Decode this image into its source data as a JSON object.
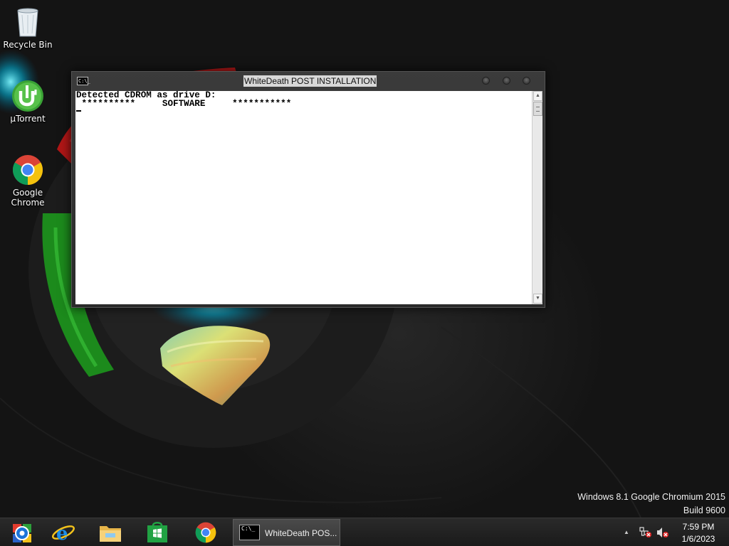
{
  "desktop": {
    "icons": [
      {
        "label": "Recycle Bin",
        "icon": "recycle-bin-icon"
      },
      {
        "label": "µTorrent",
        "icon": "utorrent-icon"
      },
      {
        "label": "Google\nChrome",
        "icon": "chrome-icon"
      }
    ]
  },
  "console": {
    "title": "WhiteDeath POST INSTALLATION",
    "icon_text": "C:\\_",
    "lines": [
      "Detected CDROM as drive D:",
      " **********     SOFTWARE     ***********"
    ]
  },
  "watermark": {
    "line1": "Windows 8.1 Google Chromium 2015",
    "line2": "Build 9600"
  },
  "taskbar": {
    "pinned": [
      {
        "icon": "media-center-icon"
      },
      {
        "icon": "internet-explorer-icon"
      },
      {
        "icon": "file-explorer-icon"
      },
      {
        "icon": "windows-store-icon"
      },
      {
        "icon": "chrome-icon"
      }
    ],
    "active_task": {
      "label": "WhiteDeath POS...",
      "icon_text": "C:\\_"
    },
    "tray": {
      "icons": [
        "network-error-icon",
        "volume-muted-icon"
      ],
      "overflow_glyph": "▲"
    },
    "clock": {
      "time": "7:59 PM",
      "date": "1/6/2023"
    }
  },
  "colors": {
    "console_bg": "#ffffff",
    "console_text": "#000000",
    "taskbar": "#1f1f1f",
    "desktop": "#141414"
  }
}
